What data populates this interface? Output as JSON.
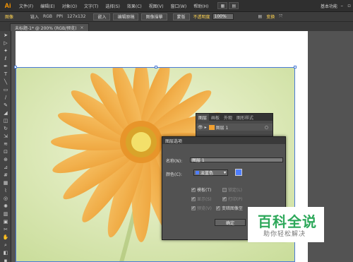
{
  "app": {
    "logo_text": "Ai",
    "workspace": "基本功能"
  },
  "menu": [
    "文件(F)",
    "编辑(E)",
    "对象(O)",
    "文字(T)",
    "选择(S)",
    "效果(C)",
    "视图(V)",
    "窗口(W)",
    "帮助(H)"
  ],
  "controlbar": {
    "image_label": "图像",
    "link_label": "链入",
    "color_mode": "RGB",
    "ppi_label": "PPI",
    "ppi_value": "127x132",
    "embed_btn": "嵌入",
    "edit_original_btn": "编辑原稿",
    "image_trace_btn": "图像描摹",
    "mask_btn": "蒙版",
    "opacity_label": "不透明度",
    "opacity_value": "100%",
    "transform_label": "变换"
  },
  "document_tab": {
    "title": "未标题-1* @ 200% (RGB/预览)",
    "close": "×"
  },
  "layers_panel": {
    "tabs": [
      "图层",
      "画板",
      "外观",
      "图形样式"
    ],
    "layer_name": "图层 1"
  },
  "dialog": {
    "title": "图层选项",
    "name_label": "名称(N):",
    "name_value": "图层 1",
    "color_label": "颜色(C):",
    "color_value": "淡蓝色",
    "checkboxes": [
      {
        "label": "模板(T)",
        "checked": true
      },
      {
        "label": "锁定(L)",
        "checked": false
      },
      {
        "label": "显示(S)",
        "checked": true
      },
      {
        "label": "打印(P)",
        "checked": true
      },
      {
        "label": "预览(V)",
        "checked": true
      },
      {
        "label": "变暗图像至",
        "checked": true
      }
    ],
    "ok_label": "确定"
  },
  "watermark": {
    "main": "百科全说",
    "sub": "助你轻松解决"
  },
  "colors": {
    "accent_orange": "#ff9a00",
    "highlight_yellow": "#ffd452",
    "layer_blue": "#4f7eff",
    "watermark_green": "#2da85a"
  }
}
